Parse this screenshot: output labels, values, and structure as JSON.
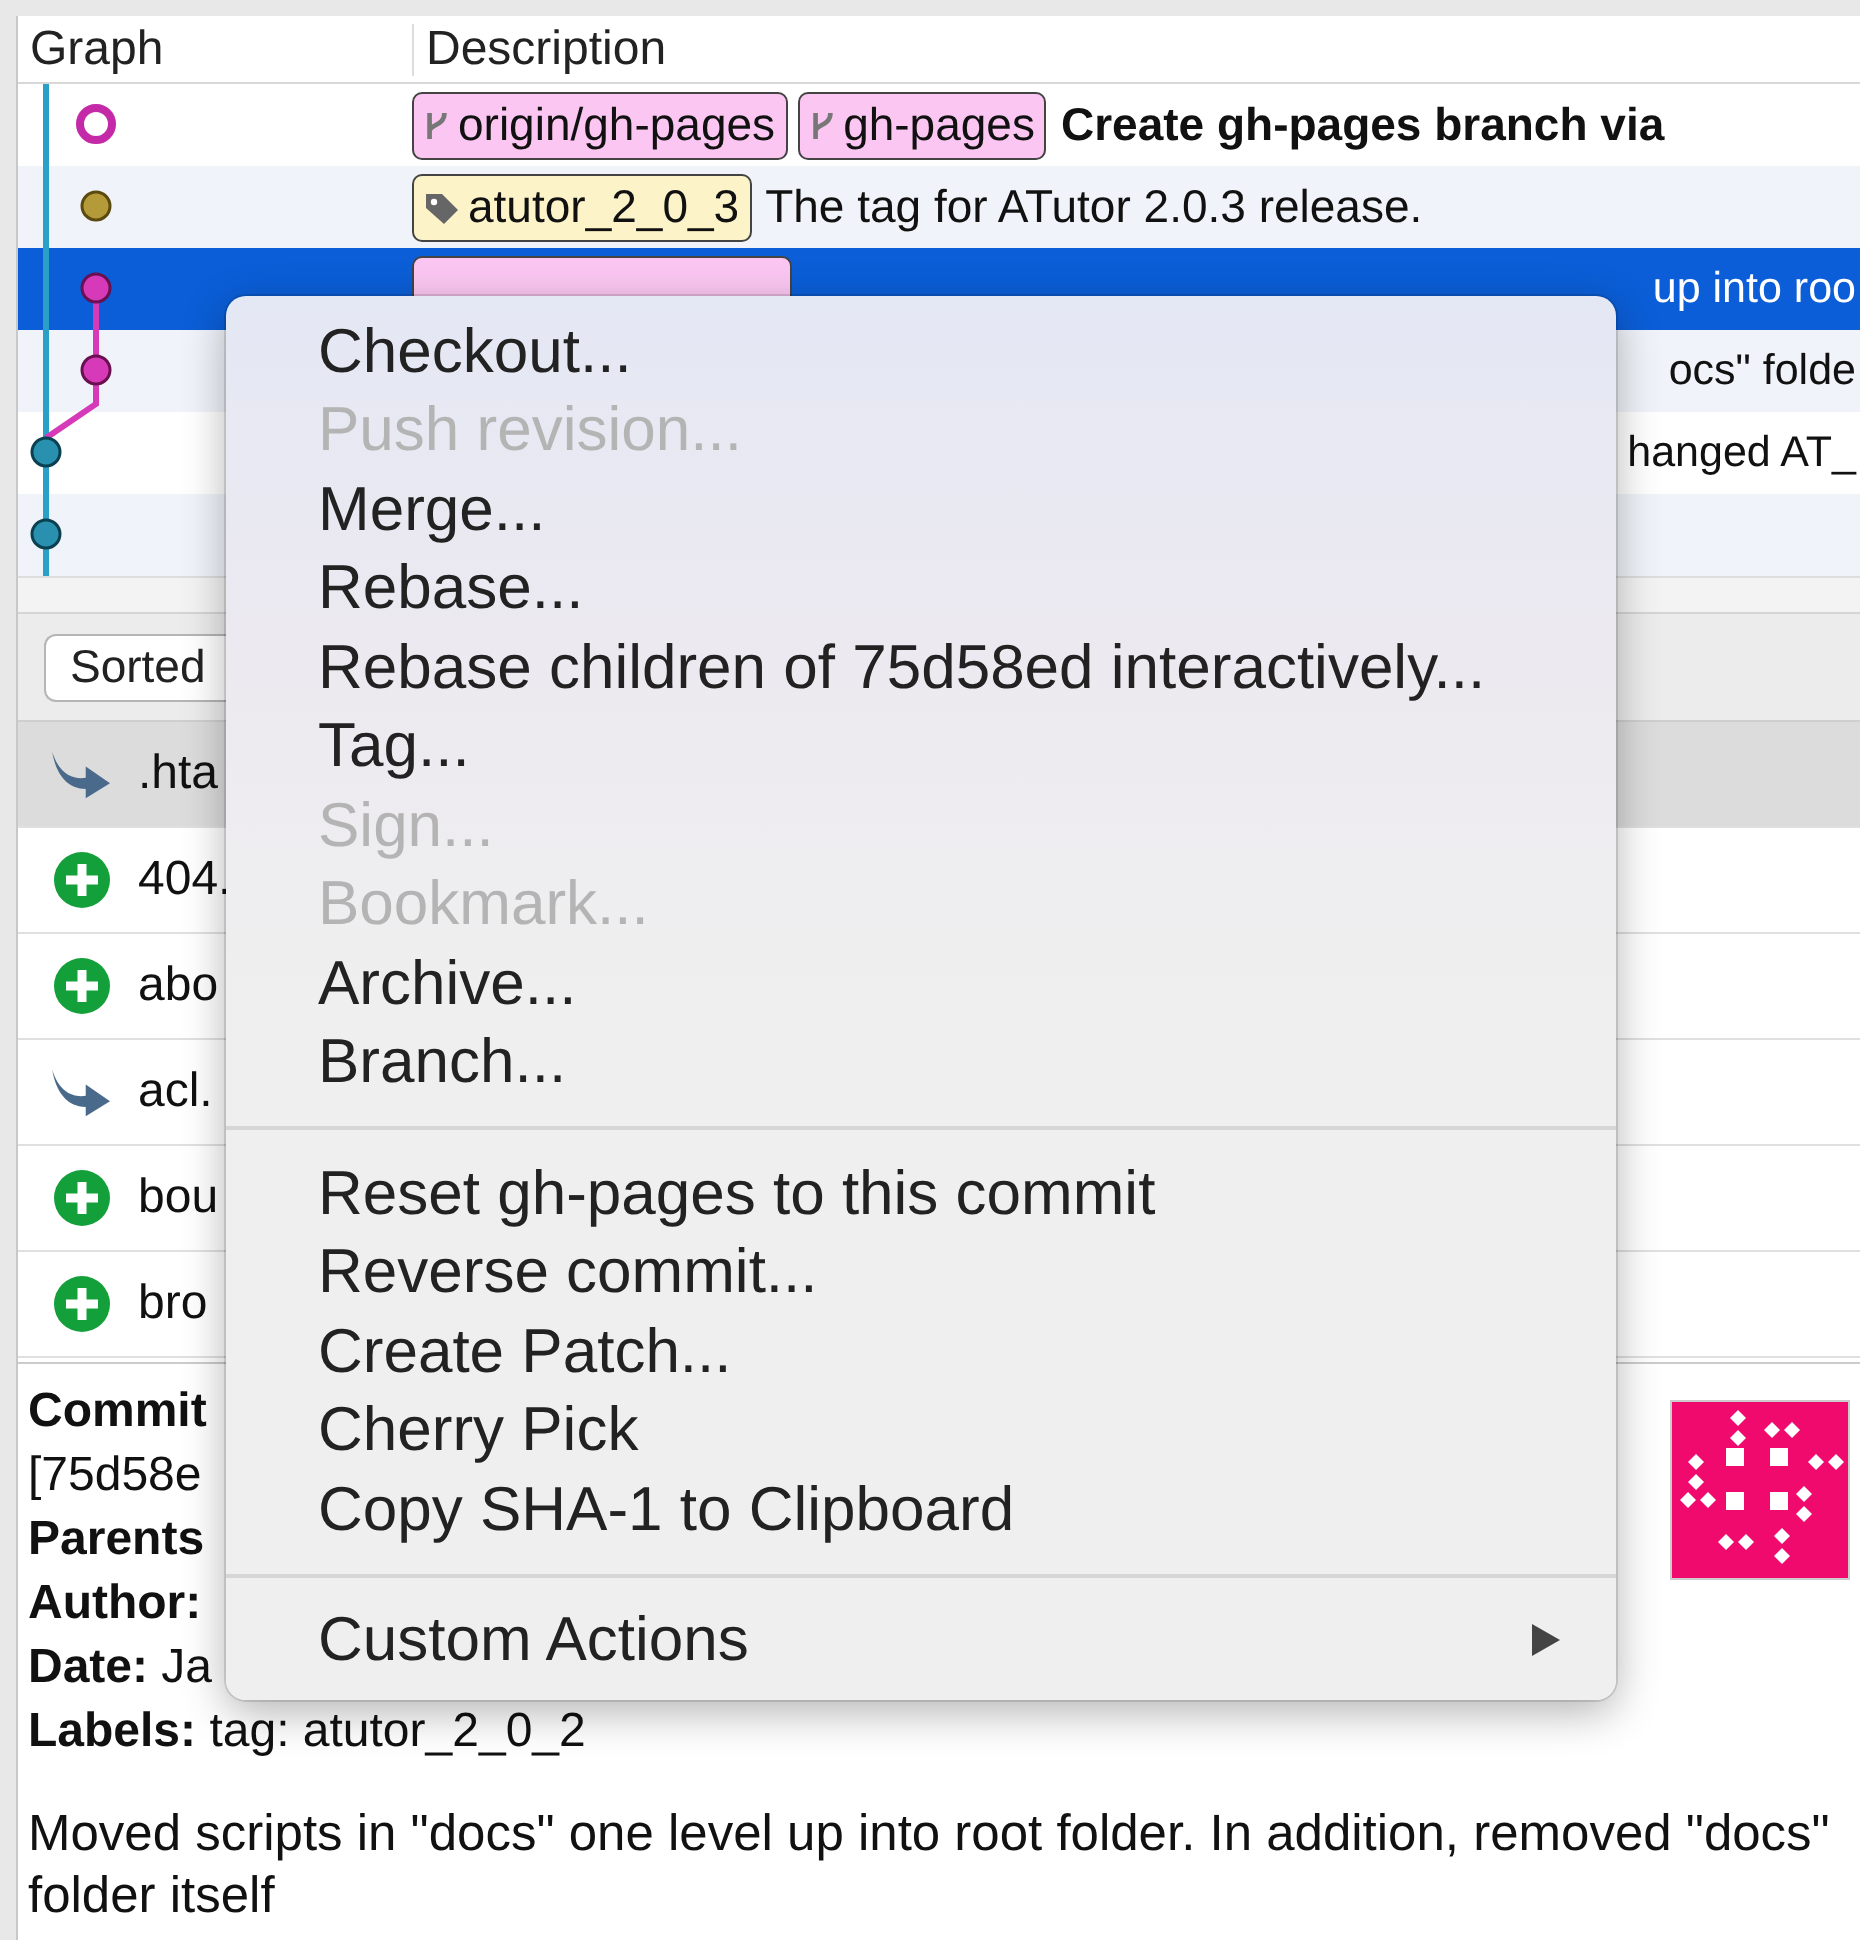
{
  "commit_list": {
    "columns": [
      "Graph",
      "Description"
    ],
    "rows": [
      {
        "selected": false,
        "head": true,
        "labels": [
          {
            "kind": "branch",
            "text": "origin/gh-pages"
          },
          {
            "kind": "branch",
            "text": "gh-pages"
          }
        ],
        "message": "Create gh-pages branch via"
      },
      {
        "selected": false,
        "head": false,
        "labels": [
          {
            "kind": "tag",
            "text": "atutor_2_0_3"
          }
        ],
        "message": "The tag for ATutor 2.0.3 release."
      },
      {
        "selected": true,
        "head": false,
        "covered": true,
        "labels": [
          {
            "kind": "branch"
          }
        ],
        "message": "up into roo"
      },
      {
        "selected": false,
        "head": false,
        "covered": true,
        "labels": [],
        "message": "ocs\" folde"
      },
      {
        "selected": false,
        "head": false,
        "covered": true,
        "labels": [],
        "message": "hanged AT_"
      },
      {
        "selected": false,
        "labels": []
      }
    ]
  },
  "toolbar": {
    "sort_button": "Sorted"
  },
  "files": [
    {
      "kind": "modified",
      "name": ".hta",
      "selected": true
    },
    {
      "kind": "added",
      "name": "404.",
      "selected": false
    },
    {
      "kind": "added",
      "name": "abo",
      "selected": false
    },
    {
      "kind": "modified",
      "name": "acl.",
      "selected": false
    },
    {
      "kind": "added",
      "name": "bou",
      "selected": false
    },
    {
      "kind": "added",
      "name": "bro",
      "selected": false
    }
  ],
  "details": {
    "lines": [
      {
        "text": "Commit",
        "bold": true
      },
      {
        "text": "[75d58e",
        "bold": false
      },
      {
        "text": "Parents",
        "bold": true
      },
      {
        "text": "Author:",
        "bold": true
      },
      {
        "text": "**Date:** Ja",
        "bold": false
      },
      {
        "text": "**Labels:** tag: atutor_2_0_2",
        "bold": false
      }
    ],
    "message": "Moved scripts in \"docs\" one level up into root folder. In addition, removed \"docs\" folder itself"
  },
  "context_menu": [
    {
      "kind": "item",
      "label": "Checkout...",
      "disabled": false
    },
    {
      "kind": "item",
      "label": "Push revision...",
      "disabled": true
    },
    {
      "kind": "item",
      "label": "Merge...",
      "disabled": false
    },
    {
      "kind": "item",
      "label": "Rebase...",
      "disabled": false
    },
    {
      "kind": "item",
      "label": "Rebase children of 75d58ed interactively...",
      "disabled": false
    },
    {
      "kind": "item",
      "label": "Tag...",
      "disabled": false
    },
    {
      "kind": "item",
      "label": "Sign...",
      "disabled": true
    },
    {
      "kind": "item",
      "label": "Bookmark...",
      "disabled": true
    },
    {
      "kind": "item",
      "label": "Archive...",
      "disabled": false
    },
    {
      "kind": "item",
      "label": "Branch...",
      "disabled": false
    },
    {
      "kind": "separator"
    },
    {
      "kind": "item",
      "label": "Reset gh-pages to this commit",
      "disabled": false
    },
    {
      "kind": "item",
      "label": "Reverse commit...",
      "disabled": false
    },
    {
      "kind": "item",
      "label": "Create Patch...",
      "disabled": false
    },
    {
      "kind": "item",
      "label": "Cherry Pick",
      "disabled": false
    },
    {
      "kind": "item",
      "label": "Copy SHA-1 to Clipboard",
      "disabled": false
    },
    {
      "kind": "separator"
    },
    {
      "kind": "submenu",
      "label": "Custom Actions",
      "disabled": false
    }
  ]
}
